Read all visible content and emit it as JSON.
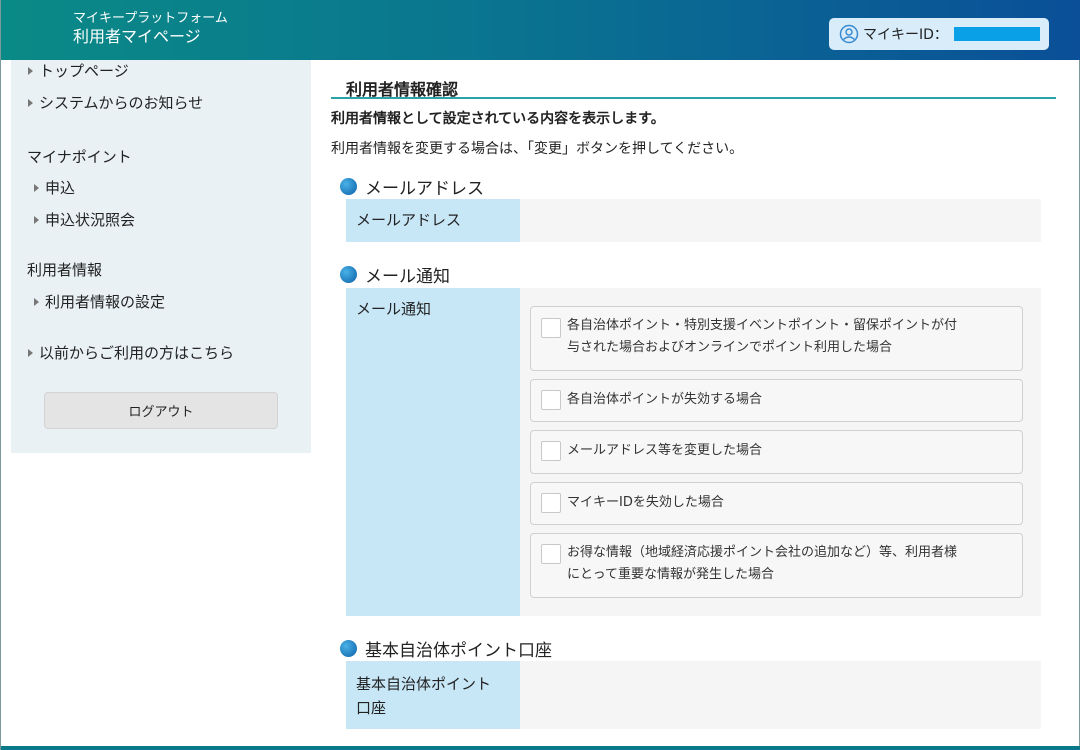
{
  "header": {
    "brand_sub": "マイキープラットフォーム",
    "brand_main": "利用者マイページ",
    "id_label": "マイキーID："
  },
  "sidebar": {
    "links_top": [
      {
        "label": "トップページ"
      },
      {
        "label": "システムからのお知らせ"
      }
    ],
    "groups": [
      {
        "heading": "マイナポイント",
        "items": [
          {
            "label": "申込"
          },
          {
            "label": "申込状況照会"
          }
        ]
      },
      {
        "heading": "利用者情報",
        "items": [
          {
            "label": "利用者情報の設定"
          }
        ]
      }
    ],
    "link_bottom": "以前からご利用の方はこちら",
    "logout_label": "ログアウト"
  },
  "main": {
    "title": "利用者情報確認",
    "desc_bold": "利用者情報として設定されている内容を表示します。",
    "desc": "利用者情報を変更する場合は、「変更」ボタンを押してください。",
    "sections": [
      {
        "heading": "メールアドレス",
        "label": "メールアドレス",
        "value": ""
      },
      {
        "heading": "メール通知",
        "label": "メール通知"
      },
      {
        "heading": "基本自治体ポイント口座",
        "label_line1": "基本自治体ポイント",
        "label_line2": "口座",
        "value": ""
      }
    ],
    "notifications": [
      {
        "line1": "各自治体ポイント・特別支援イベントポイント・留保ポイントが付",
        "line2": "与された場合およびオンラインでポイント利用した場合",
        "checked": false
      },
      {
        "line1": "各自治体ポイントが失効する場合",
        "line2": "",
        "checked": false
      },
      {
        "line1": "メールアドレス等を変更した場合",
        "line2": "",
        "checked": false
      },
      {
        "line1": "マイキーIDを失効した場合",
        "line2": "",
        "checked": false
      },
      {
        "line1": "お得な情報（地域経済応援ポイント会社の追加など）等、利用者様",
        "line2": "にとって重要な情報が発生した場合",
        "checked": false
      }
    ]
  },
  "colors": {
    "header_start": "#0a8a86",
    "header_end": "#0a4f98",
    "label_bg": "#c7e6f6",
    "sidebar_bg": "#e9f1f5",
    "accent_line": "#2aa3a8"
  }
}
